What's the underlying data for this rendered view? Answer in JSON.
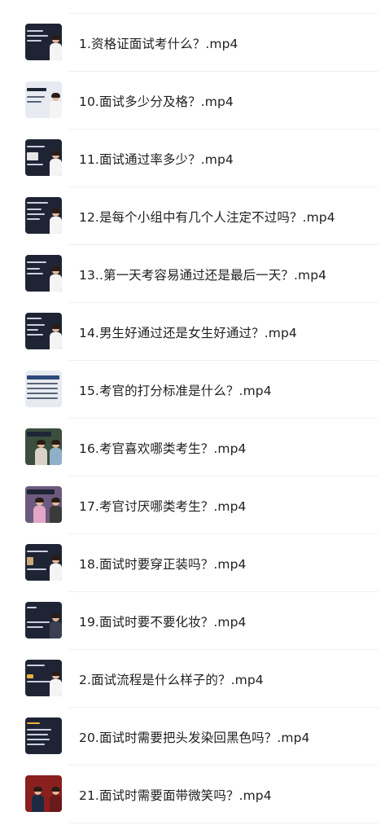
{
  "files": [
    {
      "name": "1.资格证面试考什么？.mp4",
      "thumb": "dark"
    },
    {
      "name": "10.面试多少分及格？.mp4",
      "thumb": "light"
    },
    {
      "name": "11.面试通过率多少？.mp4",
      "thumb": "dark"
    },
    {
      "name": "12.是每个小组中有几个人注定不过吗？.mp4",
      "thumb": "dark"
    },
    {
      "name": "13..第一天考容易通过还是最后一天？.mp4",
      "thumb": "dark"
    },
    {
      "name": "14.男生好通过还是女生好通过？.mp4",
      "thumb": "dark"
    },
    {
      "name": "15.考官的打分标准是什么？.mp4",
      "thumb": "light"
    },
    {
      "name": "16.考官喜欢哪类考生？.mp4",
      "thumb": "photo"
    },
    {
      "name": "17.考官讨厌哪类考生？.mp4",
      "thumb": "photo"
    },
    {
      "name": "18.面试时要穿正装吗？.mp4",
      "thumb": "dark"
    },
    {
      "name": "19.面试时要不要化妆？.mp4",
      "thumb": "dark"
    },
    {
      "name": "2.面试流程是什么样子的？.mp4",
      "thumb": "dark"
    },
    {
      "name": "20.面试时需要把头发染回黑色吗？.mp4",
      "thumb": "dark"
    },
    {
      "name": "21.面试时需要面带微笑吗？.mp4",
      "thumb": "photo"
    }
  ]
}
